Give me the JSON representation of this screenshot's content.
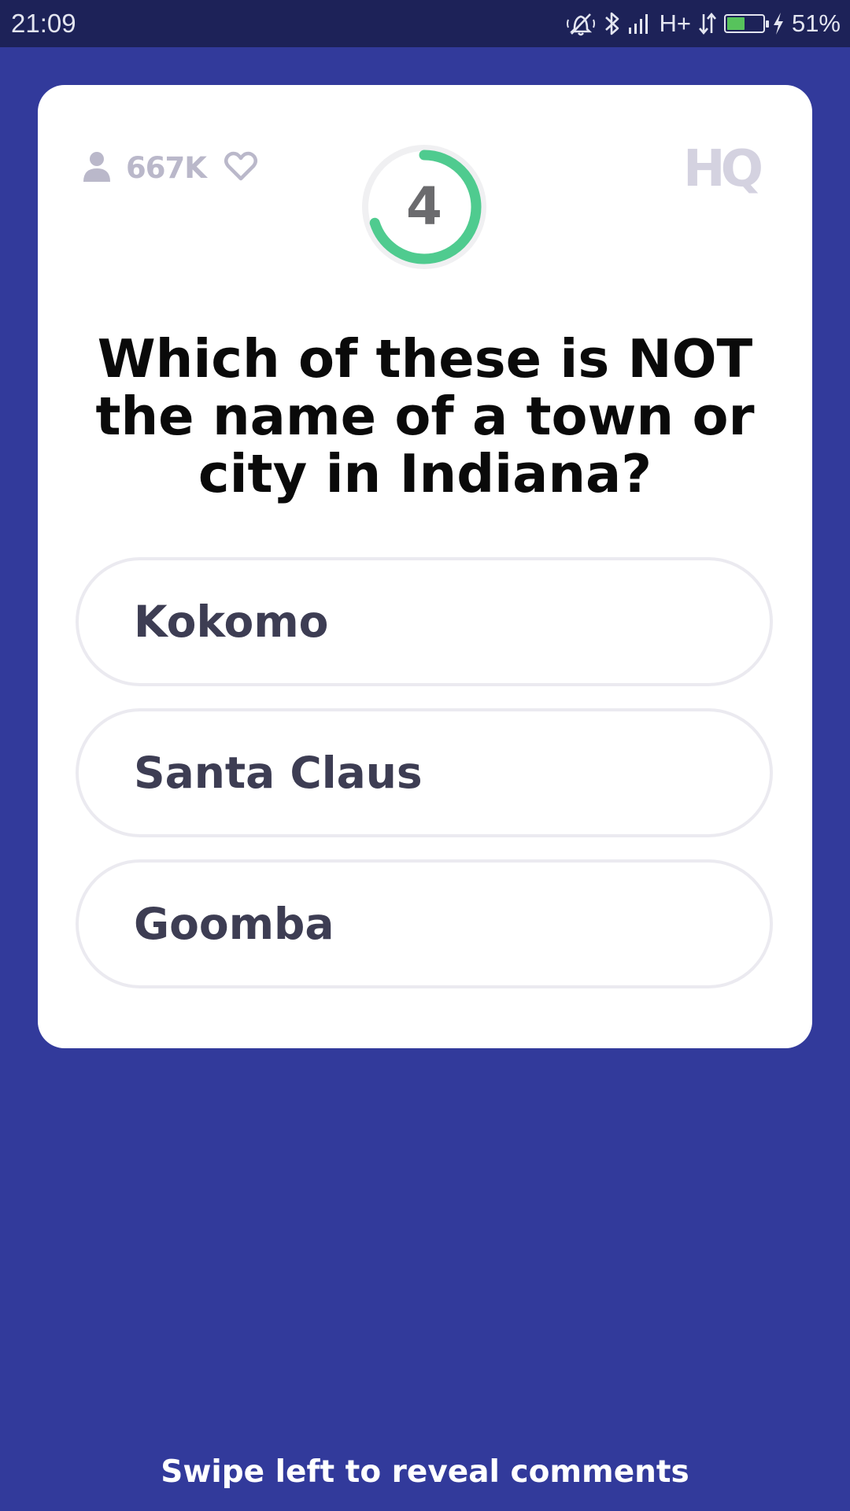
{
  "status_bar": {
    "time": "21:09",
    "network_label": "H+",
    "battery_percent": "51%",
    "battery_level": 0.51,
    "icons": [
      "silent-alarm-icon",
      "bluetooth-icon",
      "signal-icon",
      "data-arrows-icon",
      "battery-icon",
      "charging-icon"
    ]
  },
  "game": {
    "viewer_count": "667K",
    "timer_value": "4",
    "timer_remaining_fraction": 0.7,
    "logo_text": "HQ",
    "question": "Which of these is NOT the name of a town or city in Indiana?",
    "answers": [
      "Kokomo",
      "Santa Claus",
      "Goomba"
    ]
  },
  "footer": {
    "hint": "Swipe left to reveal comments"
  },
  "colors": {
    "background": "#323a9b",
    "status_bar": "#1d2258",
    "card": "#ffffff",
    "timer_green": "#4fcb8f",
    "answer_text": "#3d3d53",
    "muted_icon": "#bab8ca"
  }
}
